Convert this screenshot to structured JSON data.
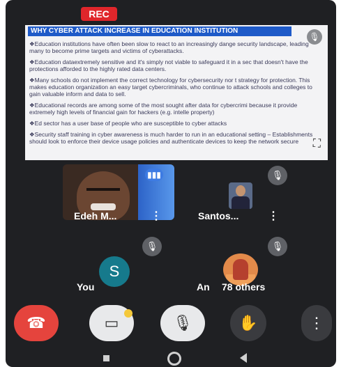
{
  "recording": {
    "label": "REC"
  },
  "presentation": {
    "title": "WHY CYBER  ATTACK INCREASE IN EDUCATION INSTITUTION",
    "paragraphs": [
      "❖Education institutions have often been slow to react to an increasingly dange security landscape, leading many to become prime targets and victims of cyberattacks.",
      "❖Education dataextremely sensitive and it's simply not viable to safeguard it in a sec that doesn't have the protections afforded to the highly rated data centers.",
      "❖Many schools do not implement the correct technology for cybersecurity nor t strategy for protection. This makes education organization an easy target cybercriminals, who continue to attack schools and colleges to gain valuable inform and data to sell.",
      "❖Educational records are among some of the most sought after data for cybercrimi because it provide extremely high levels of financial gain for hackers (e.g. intelle property)",
      "❖Ed sector has a user base of people who are susceptible to cyber attacks",
      "❖Security staff training in cyber awareness is much harder to run in an educational setting – Establishments should look to enforce their device usage policies and authenticate devices to keep the network secure"
    ]
  },
  "participants": [
    {
      "name": "Edeh M...",
      "speaking": true
    },
    {
      "name": "Santos...",
      "muted": true
    },
    {
      "name": "You",
      "avatar_letter": "S",
      "muted": true
    },
    {
      "name": "An",
      "others_label": "78 others",
      "muted": true
    }
  ],
  "colors": {
    "end_call": "#e5443d",
    "rec": "#e0262b",
    "title_bar": "#1e5ac8",
    "speaking": "#3d7be3",
    "avatar_s": "#167a8c"
  },
  "icons": {
    "end_call": "phone-hangup-icon",
    "camera": "camera-off-icon",
    "mic": "mic-off-icon",
    "hand": "raise-hand-icon",
    "more": "more-vert-icon",
    "expand": "fullscreen-icon"
  }
}
